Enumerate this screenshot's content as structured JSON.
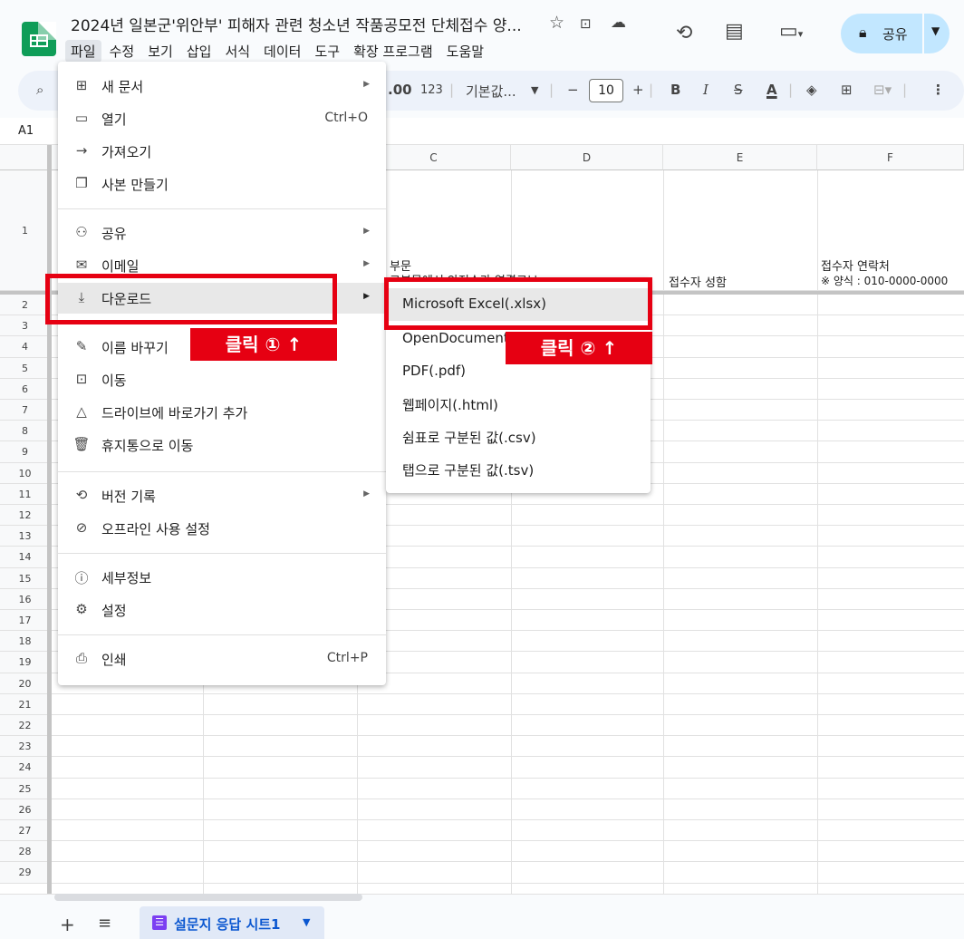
{
  "header": {
    "title": "2024년 일본군'위안부' 피해자 관련 청소년 작품공모전 단체접수 양...",
    "menus": [
      "파일",
      "수정",
      "보기",
      "삽입",
      "서식",
      "데이터",
      "도구",
      "확장 프로그램",
      "도움말"
    ],
    "share_label": "공유"
  },
  "toolbar": {
    "decimal": ".00",
    "number_format": "123",
    "font": "기본값...",
    "font_size": "10",
    "bold": "B",
    "italic": "I",
    "strike": "S",
    "text_color": "A"
  },
  "formula_bar": {
    "cell_ref": "A1"
  },
  "grid": {
    "columns": [
      "C",
      "D",
      "E",
      "F"
    ],
    "rows": [
      "1",
      "2",
      "3",
      "4",
      "5",
      "6",
      "7",
      "8",
      "9",
      "10",
      "11",
      "12",
      "13",
      "14",
      "15",
      "16",
      "17",
      "18",
      "19",
      "20",
      "21",
      "22",
      "23",
      "24",
      "25",
      "26",
      "27",
      "28",
      "29"
    ],
    "header_cells": {
      "c_line1": "부문",
      "c_line2": "그부문에서 안전수가 연결로보",
      "e": "접수자 성함",
      "f_line1": "접수자 연락처",
      "f_line2": "※ 양식 : 010-0000-0000"
    }
  },
  "file_menu": {
    "items": [
      {
        "icon": "new-doc",
        "label": "새 문서",
        "shortcut": "",
        "arrow": true
      },
      {
        "icon": "folder",
        "label": "열기",
        "shortcut": "Ctrl+O",
        "arrow": false
      },
      {
        "icon": "import",
        "label": "가져오기",
        "shortcut": "",
        "arrow": false
      },
      {
        "icon": "copy",
        "label": "사본 만들기",
        "shortcut": "",
        "arrow": false
      },
      {
        "icon": "share",
        "label": "공유",
        "shortcut": "",
        "arrow": true
      },
      {
        "icon": "email",
        "label": "이메일",
        "shortcut": "",
        "arrow": true
      },
      {
        "icon": "download",
        "label": "다운로드",
        "shortcut": "",
        "arrow": true
      },
      {
        "icon": "rename",
        "label": "이름 바꾸기",
        "shortcut": "",
        "arrow": false
      },
      {
        "icon": "move",
        "label": "이동",
        "shortcut": "",
        "arrow": false
      },
      {
        "icon": "drive-shortcut",
        "label": "드라이브에 바로가기 추가",
        "shortcut": "",
        "arrow": false
      },
      {
        "icon": "trash",
        "label": "휴지통으로 이동",
        "shortcut": "",
        "arrow": false
      },
      {
        "icon": "history",
        "label": "버전 기록",
        "shortcut": "",
        "arrow": true
      },
      {
        "icon": "offline",
        "label": "오프라인 사용 설정",
        "shortcut": "",
        "arrow": false
      },
      {
        "icon": "info",
        "label": "세부정보",
        "shortcut": "",
        "arrow": false
      },
      {
        "icon": "settings",
        "label": "설정",
        "shortcut": "",
        "arrow": false
      },
      {
        "icon": "print",
        "label": "인쇄",
        "shortcut": "Ctrl+P",
        "arrow": false
      }
    ]
  },
  "download_submenu": {
    "items": [
      "Microsoft Excel(.xlsx)",
      "OpenDocument(.ods)",
      "PDF(.pdf)",
      "웹페이지(.html)",
      "쉼표로 구분된 값(.csv)",
      "탭으로 구분된 값(.tsv)"
    ]
  },
  "annotations": {
    "click1": "클릭 ① ↑",
    "click2": "클릭 ② ↑"
  },
  "sheet_tabs": {
    "active": "설문지 응답 시트1"
  },
  "colors": {
    "accent": "#0b57d0",
    "annotation_red": "#e60012",
    "sheets_green": "#0f9d58",
    "share_bg": "#c2e7ff"
  }
}
